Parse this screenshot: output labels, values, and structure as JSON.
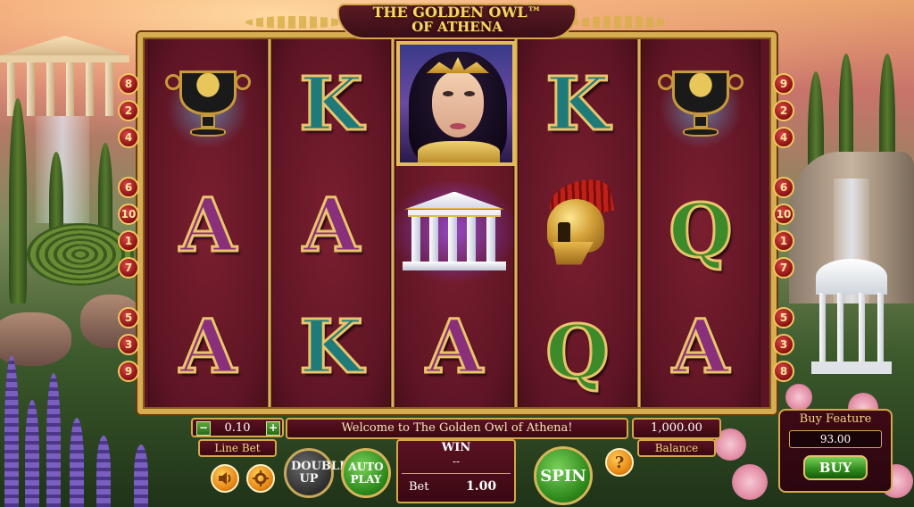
{
  "logo": {
    "line1": "THE GOLDEN OWL™",
    "line2": "OF ATHENA"
  },
  "reels": [
    [
      "urn",
      "A",
      "A"
    ],
    [
      "K",
      "A",
      "K"
    ],
    [
      "athena",
      "parthenon",
      "A"
    ],
    [
      "K",
      "helmet",
      "Q"
    ],
    [
      "urn",
      "Q",
      "A"
    ]
  ],
  "paylines_left": [
    "8",
    "2",
    "4",
    "6",
    "10",
    "1",
    "7",
    "5",
    "3",
    "9"
  ],
  "paylines_right": [
    "9",
    "2",
    "4",
    "6",
    "10",
    "1",
    "7",
    "5",
    "3",
    "8"
  ],
  "controls": {
    "line_bet_value": "0.10",
    "line_bet_label": "Line Bet",
    "minus_label": "−",
    "plus_label": "+",
    "message": "Welcome to The Golden Owl of Athena!",
    "win_label": "WIN",
    "win_value": "--",
    "bet_label": "Bet",
    "bet_value": "1.00",
    "balance_value": "1,000.00",
    "balance_label": "Balance",
    "double_up_label": "DOUBLE UP",
    "auto_play_label": "AUTO PLAY",
    "spin_label": "SPIN",
    "help_label": "?",
    "sound_icon": "speaker-icon",
    "settings_icon": "gear-icon"
  },
  "buy_feature": {
    "title": "Buy Feature",
    "price": "93.00",
    "button_label": "BUY"
  },
  "colors": {
    "gold": "#d6ad52",
    "reel_bg": "#5f1524",
    "spin_green": "#2e8a1c",
    "orange": "#e88a18"
  }
}
